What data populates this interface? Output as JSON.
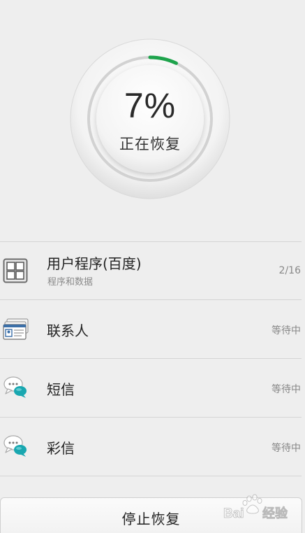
{
  "progress": {
    "percent_label": "7%",
    "value": 0.07,
    "status_label": "正在恢复",
    "accent_color": "#1ea34c"
  },
  "items": [
    {
      "title": "用户程序(百度)",
      "subtitle": "程序和数据",
      "status": "2/16",
      "icon": "app-grid-icon"
    },
    {
      "title": "联系人",
      "subtitle": "",
      "status": "等待中",
      "icon": "contacts-icon"
    },
    {
      "title": "短信",
      "subtitle": "",
      "status": "等待中",
      "icon": "sms-bubble-icon"
    },
    {
      "title": "彩信",
      "subtitle": "",
      "status": "等待中",
      "icon": "mms-bubble-icon"
    }
  ],
  "actions": {
    "stop_label": "停止恢复"
  },
  "watermark": {
    "text": "Bai经验"
  }
}
